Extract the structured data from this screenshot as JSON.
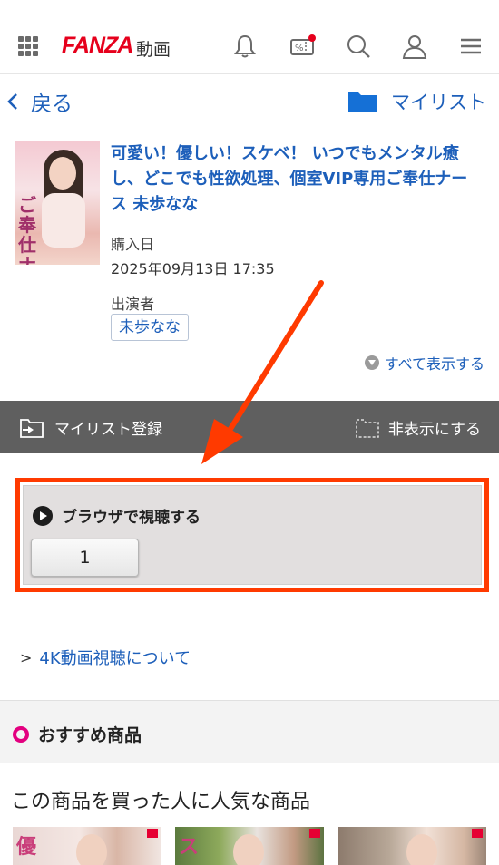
{
  "header": {
    "logo": "FANZA",
    "logo_sub": "動画",
    "icons": [
      "grid-menu-icon",
      "bell-icon",
      "coupon-icon",
      "search-icon",
      "user-icon",
      "hamburger-icon"
    ],
    "accent_color": "#e6001c"
  },
  "nav": {
    "back_label": "戻る",
    "mylist_label": "マイリスト"
  },
  "product": {
    "thumb_text": "ご奉仕ナース",
    "title": "可愛い！優しい！スケベ！ いつでもメンタル癒し、どこでも性欲処理、個室VIP専用ご奉仕ナース 未歩なな",
    "purchase_label": "購入日",
    "purchase_date": "2025年09月13日 17:35",
    "actor_label": "出演者",
    "actor": "未歩なな",
    "show_all": "すべて表示する"
  },
  "actions": {
    "register": "マイリスト登録",
    "hide": "非表示にする"
  },
  "player": {
    "label": "ブラウザで視聴する",
    "part_button": "1",
    "highlight_color": "#ff3a00"
  },
  "fourk_link": "4K動画視聴について",
  "recommend": {
    "title": "おすすめ商品",
    "subtitle": "この商品を買った人に人気な商品",
    "thumb_labels": [
      "優",
      "ス",
      ""
    ]
  }
}
